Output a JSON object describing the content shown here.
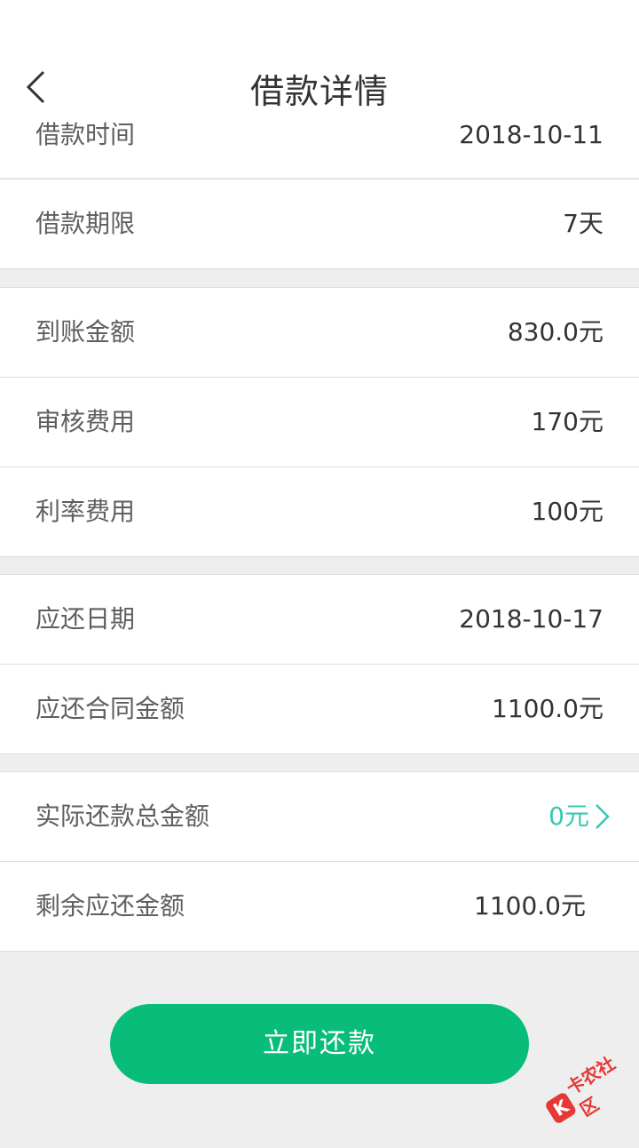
{
  "header": {
    "title": "借款详情"
  },
  "rows": [
    {
      "label": "借款时间",
      "value": "2018-10-11"
    },
    {
      "label": "借款期限",
      "value": "7天"
    },
    {
      "label": "到账金额",
      "value": "830.0元"
    },
    {
      "label": "审核费用",
      "value": "170元"
    },
    {
      "label": "利率费用",
      "value": "100元"
    },
    {
      "label": "应还日期",
      "value": "2018-10-17"
    },
    {
      "label": "应还合同金额",
      "value": "1100.0元"
    },
    {
      "label": "实际还款总金额",
      "value": "0元"
    },
    {
      "label": "剩余应还金额",
      "value": "1100.0元"
    }
  ],
  "actions": {
    "repay_label": "立即还款"
  },
  "watermark": {
    "text": "卡农社区"
  },
  "colors": {
    "accent": "#36c9b3",
    "primary_button": "#08bd79",
    "background": "#eeeeee"
  }
}
